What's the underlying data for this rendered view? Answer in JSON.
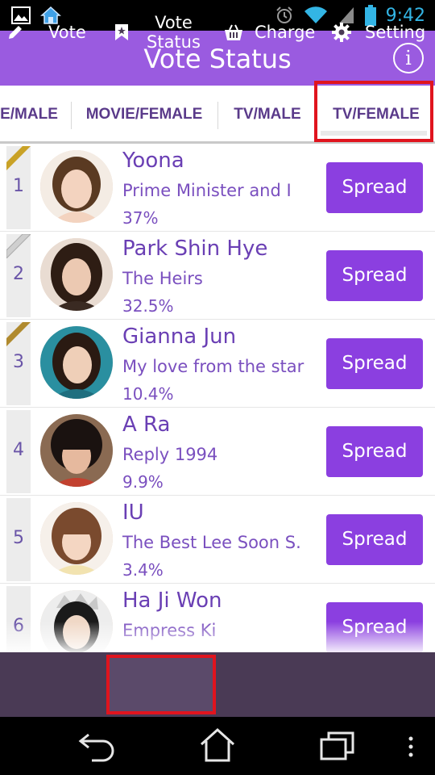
{
  "status_bar": {
    "time": "9:42",
    "left_icons": [
      "image-icon",
      "home-icon"
    ],
    "right_icons": [
      "alarm-icon",
      "wifi-icon",
      "signal-icon",
      "battery-icon"
    ]
  },
  "header": {
    "title": "Vote Status",
    "info_label": "i",
    "color": "#9a5be0"
  },
  "tabs": [
    {
      "label": "E/MALE",
      "active": false
    },
    {
      "label": "MOVIE/FEMALE",
      "active": false
    },
    {
      "label": "TV/MALE",
      "active": false
    },
    {
      "label": "TV/FEMALE",
      "active": true
    }
  ],
  "list": {
    "button_label": "Spread",
    "button_color": "#8b3fe0",
    "items": [
      {
        "rank": "1",
        "name": "Yoona",
        "title": "Prime Minister and I",
        "percent": "37%",
        "medal": "gold"
      },
      {
        "rank": "2",
        "name": "Park Shin Hye",
        "title": "The Heirs",
        "percent": "32.5%",
        "medal": "silver"
      },
      {
        "rank": "3",
        "name": "Gianna Jun",
        "title": "My love from the star",
        "percent": "10.4%",
        "medal": "bronze"
      },
      {
        "rank": "4",
        "name": "A Ra",
        "title": "Reply 1994",
        "percent": "9.9%",
        "medal": ""
      },
      {
        "rank": "5",
        "name": "IU",
        "title": "The Best Lee Soon S.",
        "percent": "3.4%",
        "medal": ""
      },
      {
        "rank": "6",
        "name": "Ha Ji Won",
        "title": "Empress Ki",
        "percent": "",
        "medal": ""
      }
    ]
  },
  "bottom_nav": {
    "vote": "Vote",
    "status_line1": "Vote",
    "status_line2": "Status",
    "charge": "Charge",
    "setting": "Setting"
  }
}
